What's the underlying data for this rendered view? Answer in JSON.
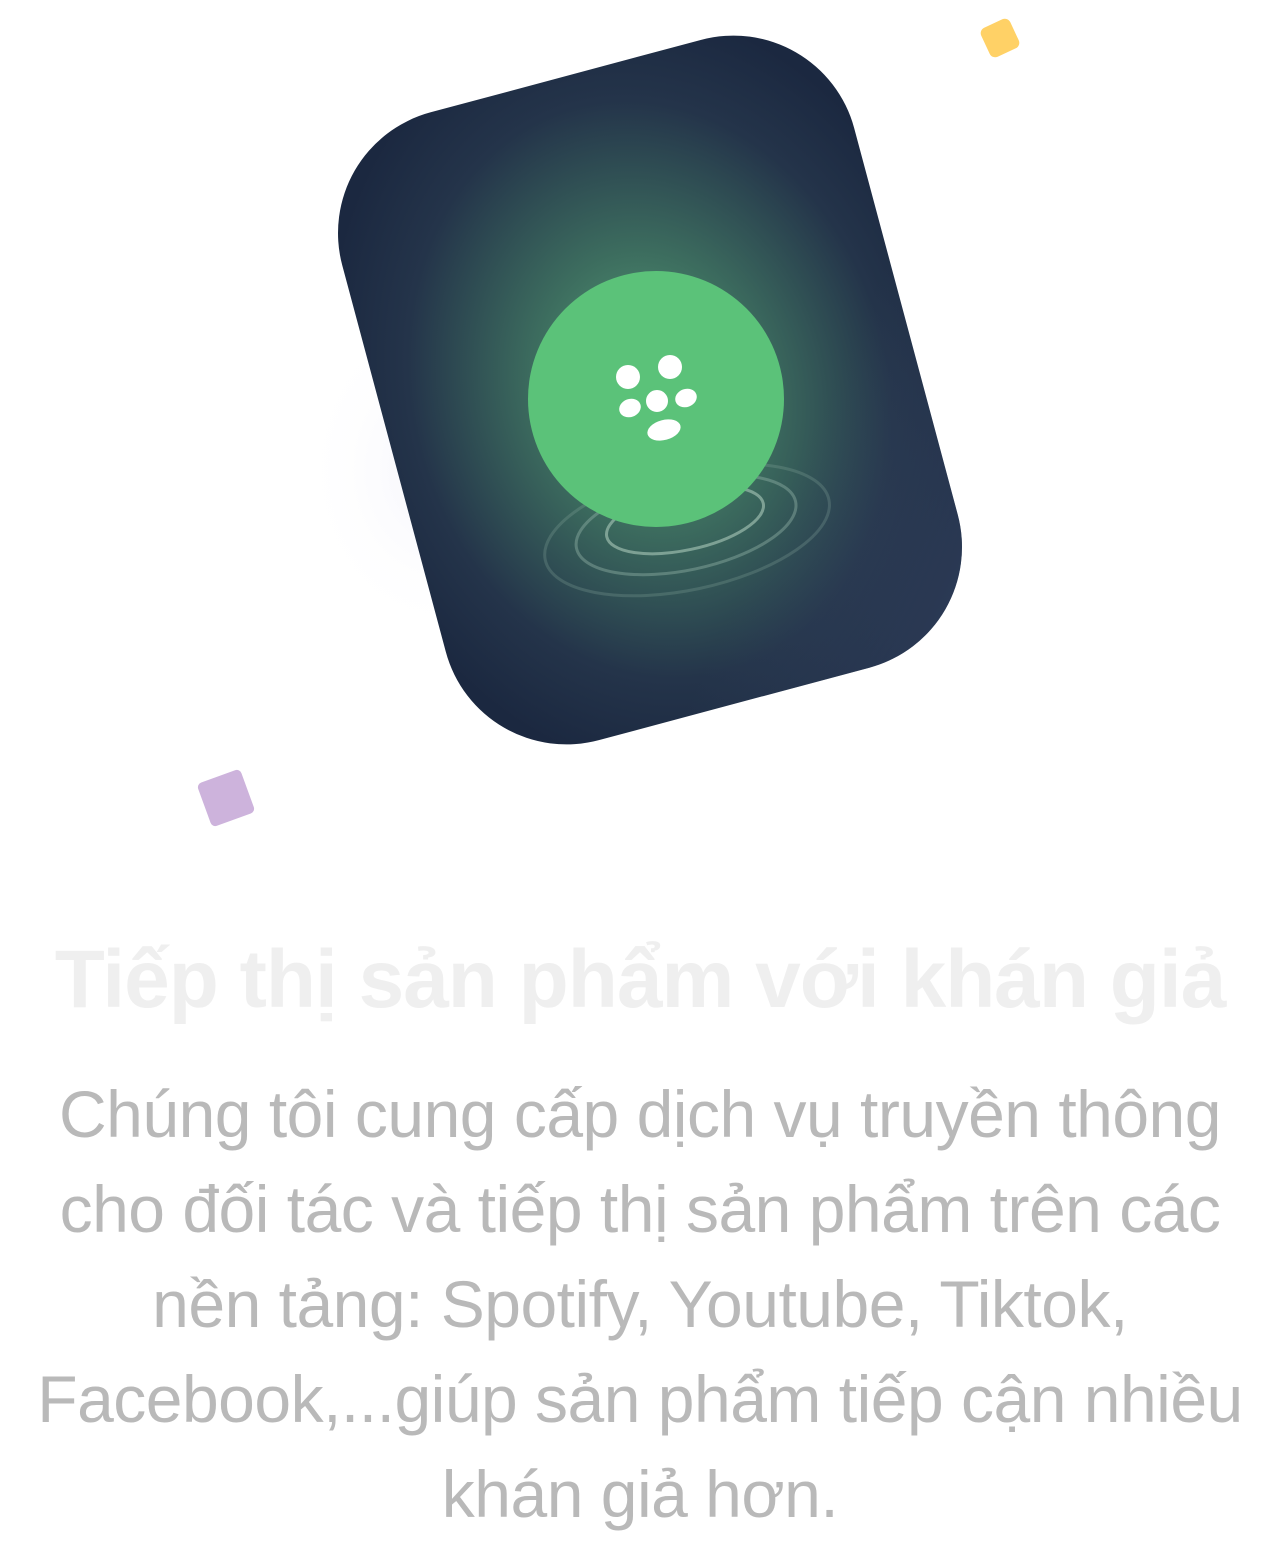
{
  "illustration": {
    "icon": "audience-group-icon",
    "card_color": "#1e2a40",
    "circle_color": "#5bc279",
    "confetti": [
      {
        "name": "yellow-confetti",
        "color": "#ffd166"
      },
      {
        "name": "purple-confetti",
        "color": "#cdb3dc"
      }
    ]
  },
  "feature": {
    "title": "Tiếp thị sản phẩm với khán giả",
    "description": "Chúng tôi cung cấp dịch vụ truyền thông cho đối tác và tiếp thị sản phẩm trên các nền tảng: Spotify, Youtube, Tiktok, Facebook,...giúp sản phẩm tiếp cận nhiều khán giả hơn."
  }
}
